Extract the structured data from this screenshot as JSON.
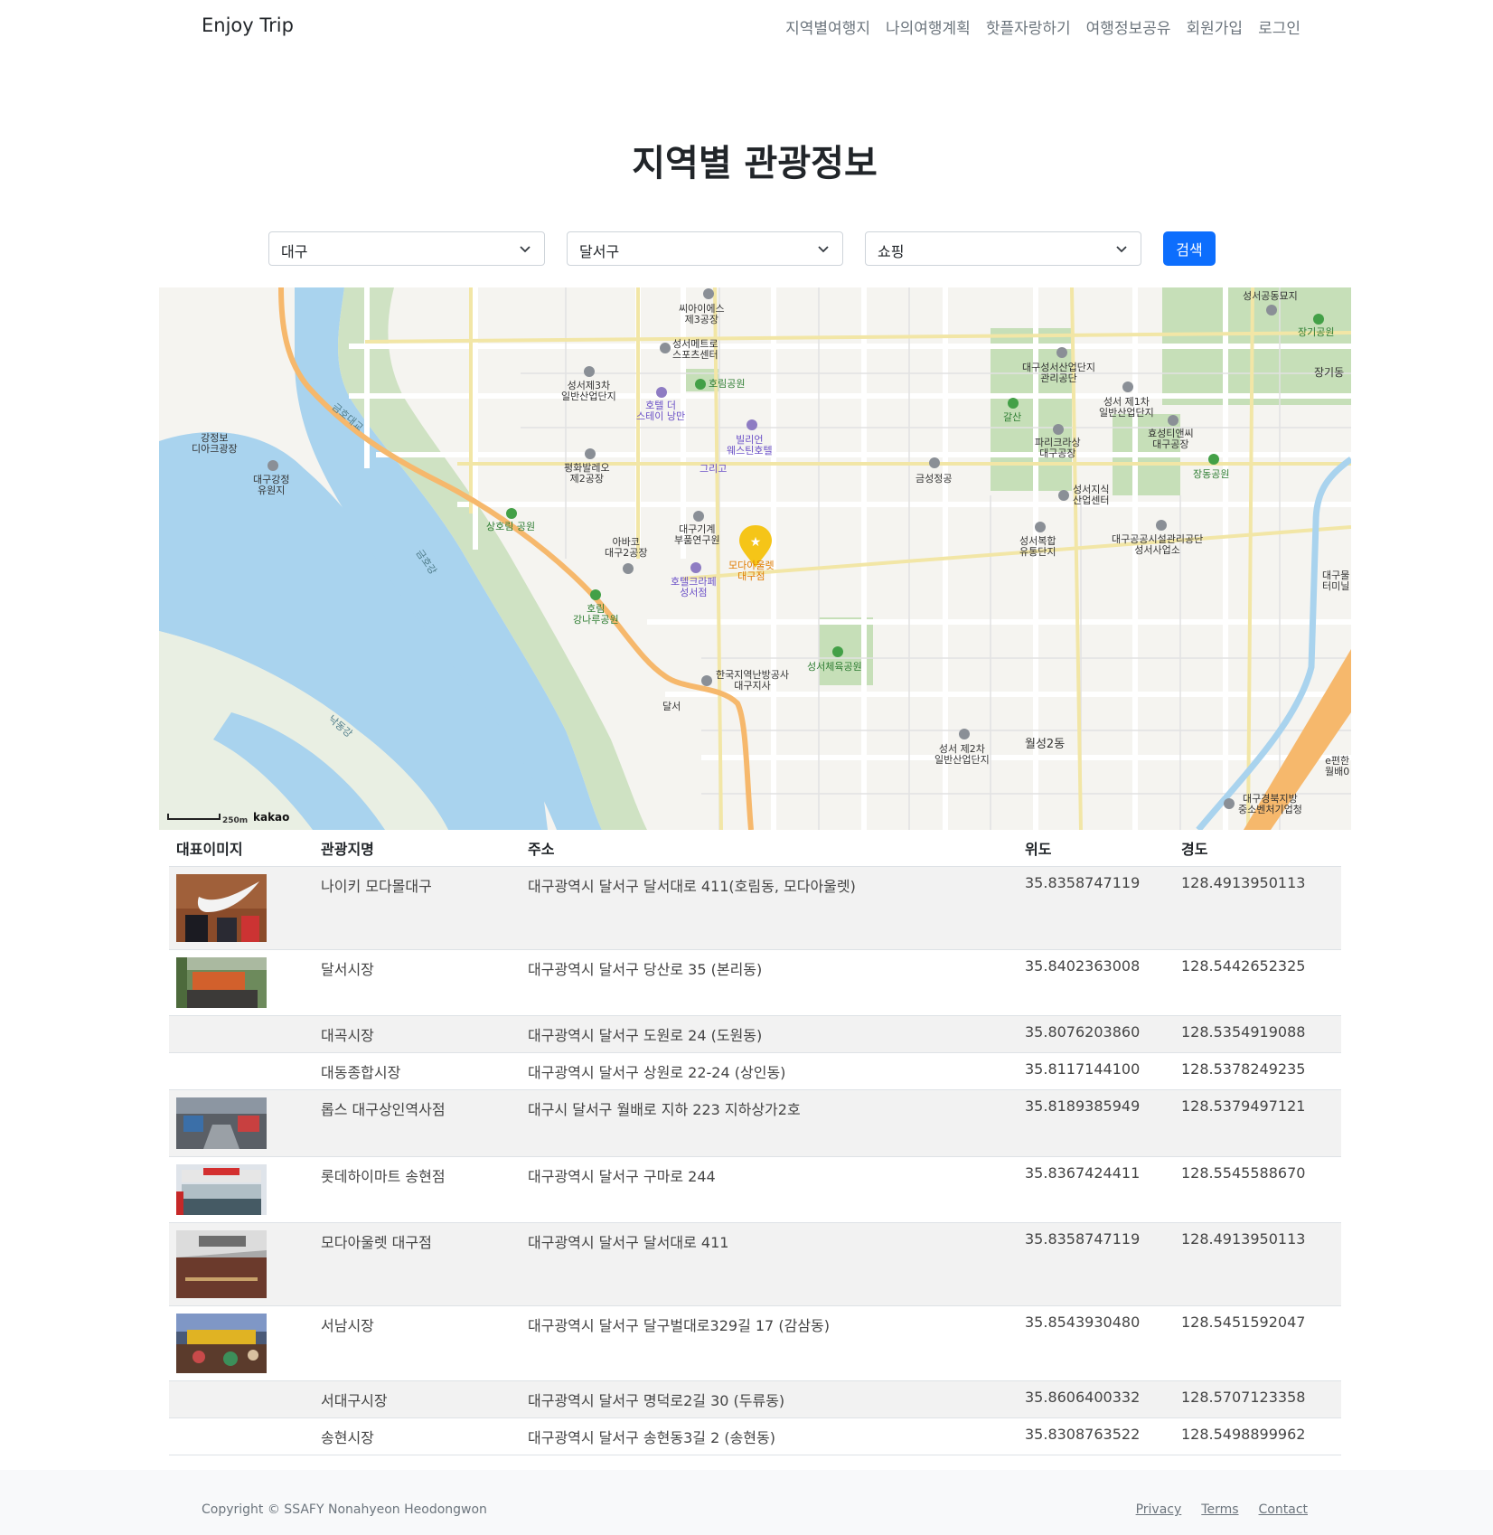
{
  "nav": {
    "brand": "Enjoy Trip",
    "items": [
      "지역별여행지",
      "나의여행계획",
      "핫플자랑하기",
      "여행정보공유",
      "회원가입",
      "로그인"
    ]
  },
  "page": {
    "title": "지역별 관광정보"
  },
  "filters": {
    "sido": "대구",
    "gugun": "달서구",
    "content_type": "쇼핑",
    "search_label": "검색",
    "accent": "#0d6efd"
  },
  "map": {
    "scale_label": "250m",
    "provider": "kakao",
    "selected_marker": "모다아울렛 대구점",
    "labels": {
      "l1": "씨아이에스\n제3공장",
      "l2": "성서메트로\n스포츠센터",
      "l3": "성서제3차\n일반산업단지",
      "l4": "호림공원",
      "l5": "호텔 더\n스테이 낭만",
      "l6": "빌리언\n웨스틴호텔",
      "l7": "그리고",
      "l8": "평화발레오\n제2공장",
      "l9": "상호림 공원",
      "l10": "대구기계\n부품연구원",
      "l11": "아바코\n대구2공장",
      "l12": "모다아울렛\n대구점",
      "l13": "호텔크라페\n성서점",
      "l14": "호림\n강나루공원",
      "l15": "한국지역난방공사\n대구지사",
      "l16": "달서",
      "l17": "성서체육공원",
      "l18": "금성정공",
      "l19": "대구성서산업단지\n관리공단",
      "l20": "갈산",
      "l21": "성서 제1차\n일반산업단지",
      "l22": "파리크라상\n대구공장",
      "l23": "효성티앤씨\n대구공장",
      "l24": "장동공원",
      "l25": "성서지식\n산업센터",
      "l26": "대구공공시설관리공단\n성서사업소",
      "l27": "성서복합\n유통단지",
      "l28": "성서 제2차\n일반산업단지",
      "l29": "월성2동",
      "l30": "대구경북지방\n중소벤처기업청",
      "l31": "성서공동묘지",
      "l32": "장기공원",
      "l33": "장기동",
      "l34": "강정보\n디아크광장",
      "l35": "대구강정\n유원지",
      "l36": "금호대교",
      "l37": "금호강",
      "l38": "낙동강",
      "l39": "대구물\n터미닐",
      "l40": "e편한\n월배0"
    }
  },
  "table": {
    "headers": [
      "대표이미지",
      "관광지명",
      "주소",
      "위도",
      "경도"
    ],
    "rows": [
      {
        "name": "나이키 모다몰대구",
        "addr": "대구광역시 달서구 달서대로 411(호림동, 모다아울렛)",
        "lat": "35.8358747119",
        "lng": "128.4913950113",
        "img": "nike"
      },
      {
        "name": "달서시장",
        "addr": "대구광역시 달서구 당산로 35 (본리동)",
        "lat": "35.8402363008",
        "lng": "128.5442652325",
        "img": "market"
      },
      {
        "name": "대곡시장",
        "addr": "대구광역시 달서구 도원로 24 (도원동)",
        "lat": "35.8076203860",
        "lng": "128.5354919088",
        "img": ""
      },
      {
        "name": "대동종합시장",
        "addr": "대구광역시 달서구 상원로 22-24 (상인동)",
        "lat": "35.8117144100",
        "lng": "128.5378249235",
        "img": ""
      },
      {
        "name": "롭스 대구상인역사점",
        "addr": "대구시 달서구 월배로 지하 223 지하상가2호",
        "lat": "35.8189385949",
        "lng": "128.5379497121",
        "img": "underground"
      },
      {
        "name": "롯데하이마트 송현점",
        "addr": "대구광역시 달서구 구마로 244",
        "lat": "35.8367424411",
        "lng": "128.5545588670",
        "img": "mart"
      },
      {
        "name": "모다아울렛 대구점",
        "addr": "대구광역시 달서구 달서대로 411",
        "lat": "35.8358747119",
        "lng": "128.4913950113",
        "img": "moda"
      },
      {
        "name": "서남시장",
        "addr": "대구광역시 달서구 달구벌대로329길 17 (감삼동)",
        "lat": "35.8543930480",
        "lng": "128.5451592047",
        "img": "seonam"
      },
      {
        "name": "서대구시장",
        "addr": "대구광역시 달서구 명덕로2길 30 (두류동)",
        "lat": "35.8606400332",
        "lng": "128.5707123358",
        "img": ""
      },
      {
        "name": "송현시장",
        "addr": "대구광역시 달서구 송현동3길 2 (송현동)",
        "lat": "35.8308763522",
        "lng": "128.5498899962",
        "img": ""
      }
    ]
  },
  "footer": {
    "copyright": "Copyright © SSAFY Nonahyeon Heodongwon",
    "links": [
      "Privacy",
      "Terms",
      "Contact"
    ]
  }
}
